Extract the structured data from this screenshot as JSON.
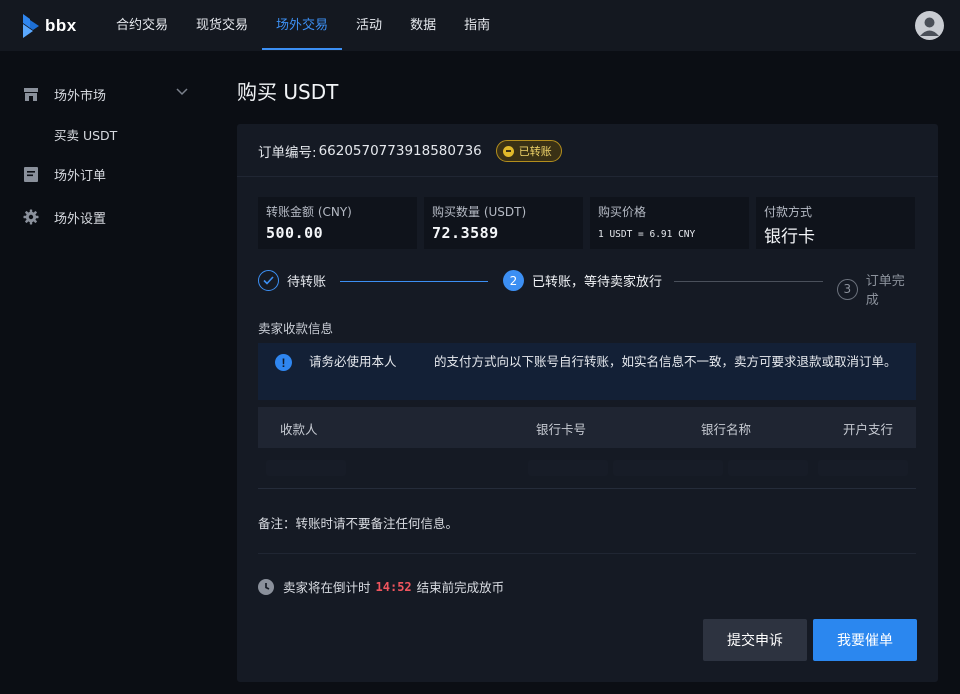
{
  "brand": {
    "name": "bbx",
    "accent": "#3c8ff3"
  },
  "nav": {
    "items": [
      {
        "label": "合约交易",
        "active": false
      },
      {
        "label": "现货交易",
        "active": false
      },
      {
        "label": "场外交易",
        "active": true
      },
      {
        "label": "活动",
        "active": false
      },
      {
        "label": "数据",
        "active": false
      },
      {
        "label": "指南",
        "active": false
      }
    ],
    "avatar_icon": "user-avatar-icon"
  },
  "sidebar": {
    "items": [
      {
        "label": "场外市场",
        "icon": "store-icon",
        "expanded": true
      },
      {
        "label": "买卖 USDT",
        "sub": true
      },
      {
        "label": "场外订单",
        "icon": "order-icon"
      },
      {
        "label": "场外设置",
        "icon": "gear-icon"
      }
    ]
  },
  "page": {
    "title": "购买 USDT"
  },
  "order": {
    "number_label": "订单编号:",
    "number": "6620570773918580736",
    "status": "已转账",
    "status_color": "#e0b92b"
  },
  "stats": [
    {
      "label": "转账金额 (CNY)",
      "value": "500.00"
    },
    {
      "label": "购买数量 (USDT)",
      "value": "72.3589"
    },
    {
      "label": "购买价格",
      "value": "1 USDT = 6.91 CNY"
    },
    {
      "label": "付款方式",
      "value": "银行卡"
    }
  ],
  "steps": [
    {
      "label": "待转账",
      "state": "done"
    },
    {
      "number": "2",
      "label": "已转账，等待卖家放行",
      "state": "current"
    },
    {
      "number": "3",
      "label": "订单完成",
      "state": "pending"
    }
  ],
  "seller_info": {
    "label": "卖家收款信息",
    "notice_icon": "!",
    "notice": "请务必使用本人　　　的支付方式向以下账号自行转账，如实名信息不一致，卖方可要求退款或取消订单。",
    "columns": [
      "收款人",
      "银行卡号",
      "银行名称",
      "开户支行"
    ]
  },
  "remark": "备注：转账时请不要备注任何信息。",
  "countdown": {
    "prefix": "卖家将在倒计时",
    "time": "14:52",
    "suffix": "结束前完成放币"
  },
  "actions": {
    "appeal": "提交申诉",
    "urge": "我要催单"
  }
}
